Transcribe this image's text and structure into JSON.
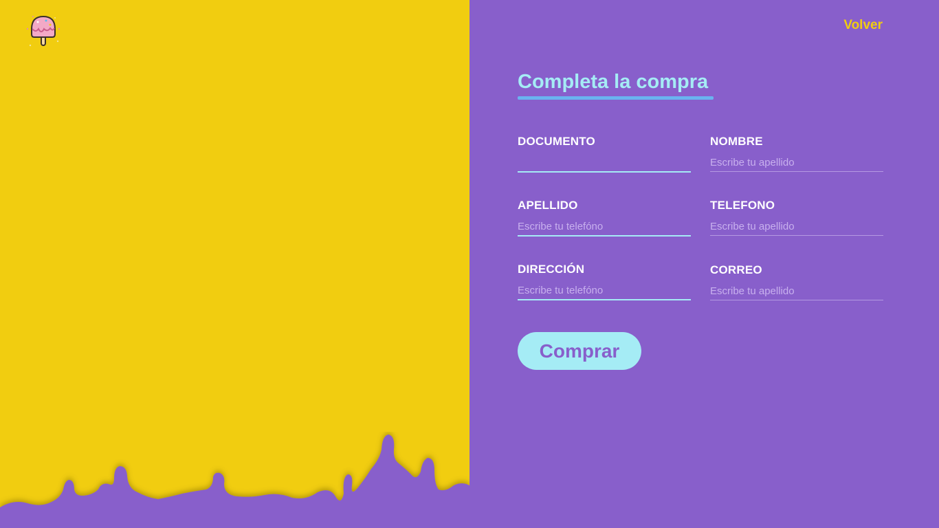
{
  "header": {
    "back_label": "Volver"
  },
  "form": {
    "title": "Completa la compra",
    "fields": [
      {
        "label": "DOCUMENTO",
        "placeholder": "",
        "value": ""
      },
      {
        "label": "NOMBRE",
        "placeholder": "Escribe tu apellido",
        "value": ""
      },
      {
        "label": "APELLIDO",
        "placeholder": "Escribe tu telefóno",
        "value": ""
      },
      {
        "label": "TELEFONO",
        "placeholder": "Escribe tu apellido",
        "value": ""
      },
      {
        "label": "DIRECCIÓN",
        "placeholder": "Escribe tu telefóno",
        "value": ""
      },
      {
        "label": "CORREO",
        "placeholder": "Escribe tu apellido",
        "value": ""
      }
    ],
    "submit_label": "Comprar"
  },
  "colors": {
    "yellow": "#f1cd10",
    "purple": "#885fcb",
    "accent": "#a5ecf5"
  },
  "icons": {
    "logo": "ice-cream-icon"
  }
}
